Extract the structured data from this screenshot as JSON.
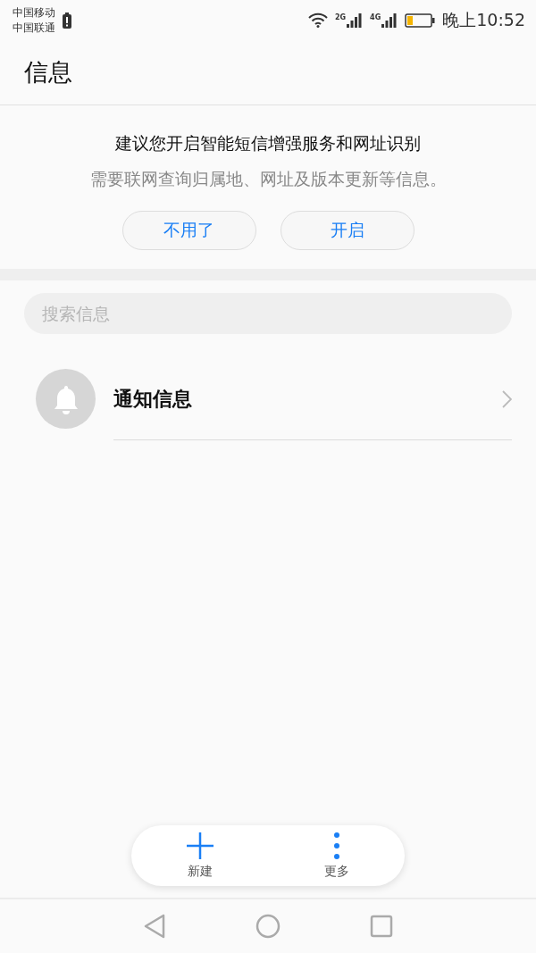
{
  "status_bar": {
    "carriers": [
      "中国移动",
      "中国联通"
    ],
    "network_labels": [
      "2G",
      "4G"
    ],
    "time": "晚上10:52"
  },
  "header": {
    "title": "信息"
  },
  "banner": {
    "title": "建议您开启智能短信增强服务和网址识别",
    "description": "需要联网查询归属地、网址及版本更新等信息。",
    "buttons": [
      "不用了",
      "开启"
    ]
  },
  "search": {
    "placeholder": "搜索信息"
  },
  "conversations": [
    {
      "title": "通知信息"
    }
  ],
  "actions": [
    {
      "kind": "add",
      "label": "新建"
    },
    {
      "kind": "more",
      "label": "更多"
    }
  ]
}
